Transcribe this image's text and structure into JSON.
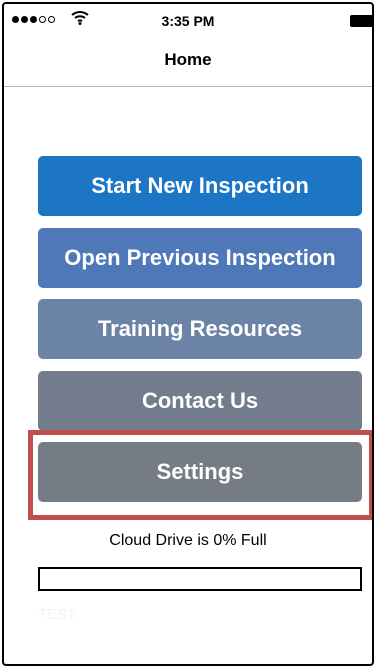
{
  "status_bar": {
    "time": "3:35 PM",
    "signal_icon": "signal-dots-icon",
    "wifi_icon": "wifi-icon",
    "battery_icon": "battery-icon"
  },
  "nav": {
    "title": "Home"
  },
  "menu": {
    "start_label": "Start New Inspection",
    "open_label": "Open Previous Inspection",
    "training_label": "Training Resources",
    "contact_label": "Contact Us",
    "settings_label": "Settings"
  },
  "cloud": {
    "status_text": "Cloud Drive is 0% Full",
    "percent_full": 0
  },
  "test_label": "TEST",
  "colors": {
    "start": "#1c76c5",
    "open": "#4f78b8",
    "training": "#6c83a8",
    "contact": "#737c8c",
    "settings": "#767c86",
    "highlight": "#c0504d"
  }
}
